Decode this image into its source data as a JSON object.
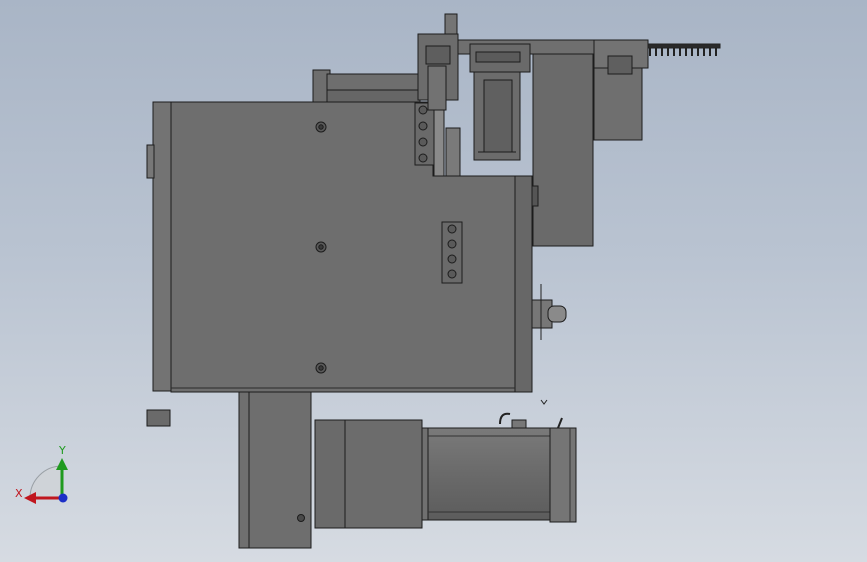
{
  "viewport": {
    "background_top": "#a9b5c6",
    "background_bottom": "#d6dbe2",
    "model_fill": "#6e6e6e",
    "model_fill_dark": "#5b5b5b",
    "model_edge": "#1c1c1c"
  },
  "triad": {
    "x_label": "X",
    "y_label": "Y",
    "x_color": "#c0161e",
    "y_color": "#1f9a1f",
    "z_color": "#1c2fc7"
  }
}
